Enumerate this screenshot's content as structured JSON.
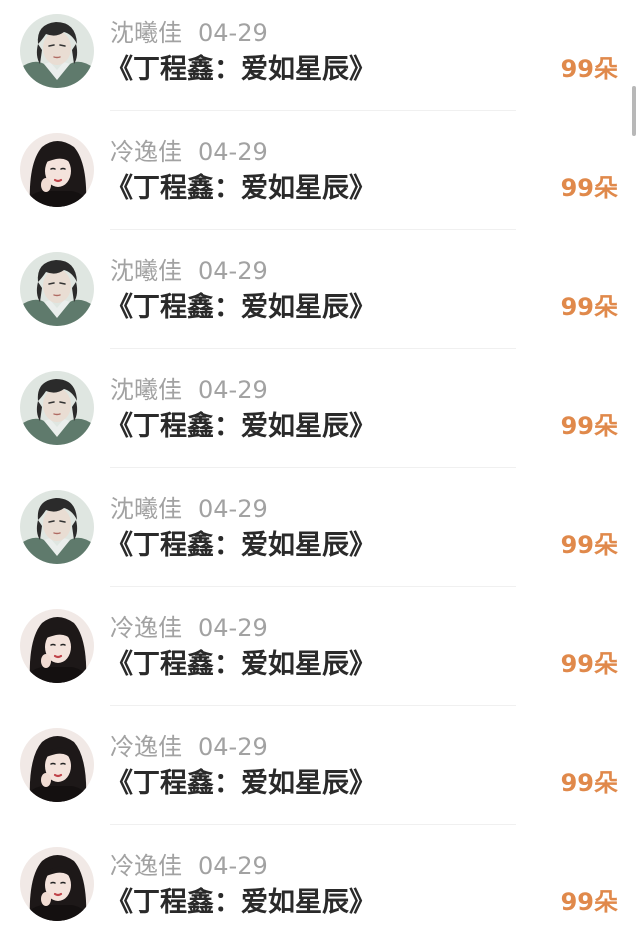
{
  "theme": {
    "name_color": "#a2a2a2",
    "title_color": "#2a2a2a",
    "amount_color": "#e0894b"
  },
  "entries": [
    {
      "avatar": "male-illustrated-avatar",
      "name": "沈曦佳",
      "date": "04-29",
      "title": "《丁程鑫：爱如星辰》",
      "amount": "99朵"
    },
    {
      "avatar": "female-portrait-avatar",
      "name": "冷逸佳",
      "date": "04-29",
      "title": "《丁程鑫：爱如星辰》",
      "amount": "99朵"
    },
    {
      "avatar": "male-illustrated-avatar",
      "name": "沈曦佳",
      "date": "04-29",
      "title": "《丁程鑫：爱如星辰》",
      "amount": "99朵"
    },
    {
      "avatar": "male-illustrated-avatar",
      "name": "沈曦佳",
      "date": "04-29",
      "title": "《丁程鑫：爱如星辰》",
      "amount": "99朵"
    },
    {
      "avatar": "male-illustrated-avatar",
      "name": "沈曦佳",
      "date": "04-29",
      "title": "《丁程鑫：爱如星辰》",
      "amount": "99朵"
    },
    {
      "avatar": "female-portrait-avatar",
      "name": "冷逸佳",
      "date": "04-29",
      "title": "《丁程鑫：爱如星辰》",
      "amount": "99朵"
    },
    {
      "avatar": "female-portrait-avatar",
      "name": "冷逸佳",
      "date": "04-29",
      "title": "《丁程鑫：爱如星辰》",
      "amount": "99朵"
    },
    {
      "avatar": "female-portrait-avatar",
      "name": "冷逸佳",
      "date": "04-29",
      "title": "《丁程鑫：爱如星辰》",
      "amount": "99朵"
    }
  ]
}
